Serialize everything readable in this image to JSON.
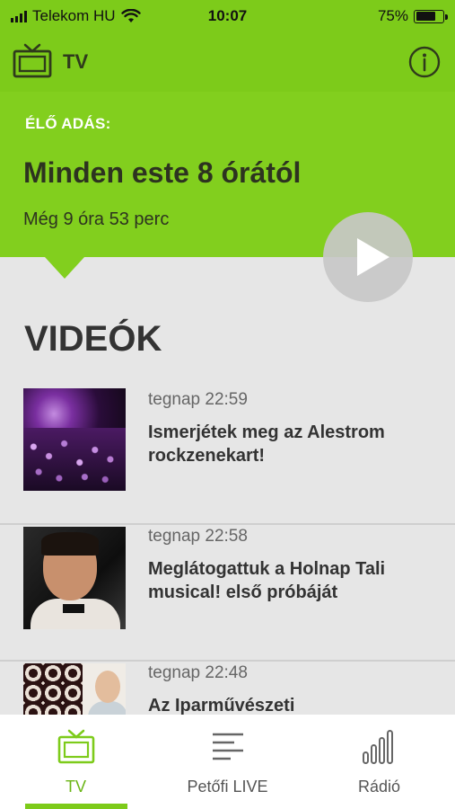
{
  "status_bar": {
    "carrier": "Telekom HU",
    "time": "10:07",
    "battery_percent": "75%",
    "battery_level": 0.75
  },
  "nav": {
    "title": "TV",
    "left_icon": "tv-icon",
    "right_icon": "info-icon"
  },
  "live": {
    "label": "ÉLŐ ADÁS:",
    "title": "Minden este 8 órától",
    "countdown": "Még 9 óra 53 perc",
    "play_icon": "play-icon"
  },
  "videos": {
    "section_title": "VIDEÓK",
    "items": [
      {
        "time": "tegnap 22:59",
        "title": "Ismerjétek meg az Alestrom rockzenekart!"
      },
      {
        "time": "tegnap 22:58",
        "title": "Meglátogattuk a Holnap Tali musical! első próbáját"
      },
      {
        "time": "tegnap 22:48",
        "title": "Az Iparművészeti"
      }
    ]
  },
  "tabs": [
    {
      "label": "TV",
      "icon": "tv-icon",
      "active": true
    },
    {
      "label": "Petőfi LIVE",
      "icon": "list-icon",
      "active": false
    },
    {
      "label": "Rádió",
      "icon": "signal-bars-icon",
      "active": false
    }
  ],
  "colors": {
    "brand_green": "#7dcb1a",
    "banner_green": "#82cf1e",
    "background": "#e6e6e6"
  }
}
